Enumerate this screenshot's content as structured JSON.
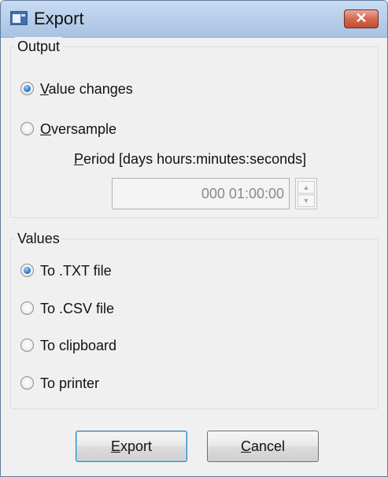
{
  "window": {
    "title": "Export",
    "close_label": "✕"
  },
  "output": {
    "legend": "Output",
    "options": [
      {
        "label": "Value changes",
        "checked": true
      },
      {
        "label": "Oversample",
        "checked": false
      }
    ],
    "period_label": "Period [days hours:minutes:seconds]",
    "period_value": "000 01:00:00",
    "spin_up": "▲",
    "spin_down": "▼"
  },
  "values": {
    "legend": "Values",
    "options": [
      {
        "label": "To .TXT file",
        "checked": true
      },
      {
        "label": "To .CSV file",
        "checked": false
      },
      {
        "label": "To clipboard",
        "checked": false
      },
      {
        "label": "To printer",
        "checked": false
      }
    ]
  },
  "buttons": {
    "export": "Export",
    "cancel": "Cancel"
  },
  "colors": {
    "accent": "#2f7fd6",
    "close_button": "#c44a31"
  }
}
